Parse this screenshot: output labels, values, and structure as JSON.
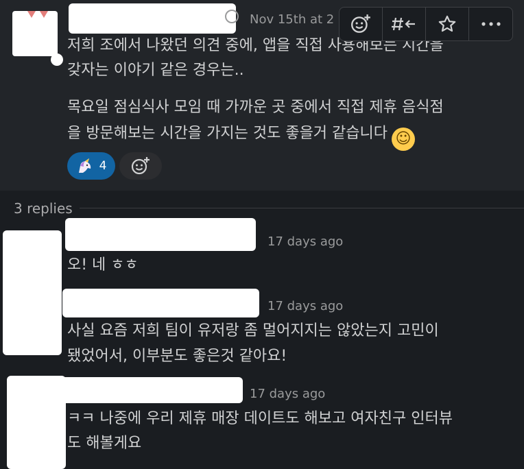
{
  "parent": {
    "timestamp": "Nov 15th at 2",
    "paragraph1_line1": "저희 조에서 나왔던 의견 중에, 앱을 직접 사용해보는 시간을",
    "paragraph1_line2": "갖자는 이야기 같은 경우는..",
    "paragraph2_line1": "목요일 점심식사 모임 때 가까운 곳 중에서 직접 제휴 음식점",
    "paragraph2_line2": "을 방문해보는 시간을 가지는 것도 좋을거 같습니다",
    "reactions": [
      {
        "emoji": "unicorn",
        "count": "4"
      }
    ]
  },
  "toolbar": {
    "icons": [
      "add-reaction-icon",
      "reply-in-channel-icon",
      "star-icon",
      "more-actions-icon"
    ]
  },
  "thread": {
    "replies_label": "3 replies",
    "replies": [
      {
        "timestamp": "17 days ago",
        "lines": [
          "오! 네 ㅎㅎ"
        ]
      },
      {
        "timestamp": "17 days ago",
        "lines": [
          "사실 요즘 저희 팀이 유저랑 좀 멀어지지는 않았는지 고민이",
          "됐었어서, 이부분도 좋은것 같아요!"
        ]
      },
      {
        "timestamp": "17 days ago",
        "lines": [
          "ㅋㅋ 나중에 우리 제휴 매장 데이트도 해보고 여자친구 인터뷰",
          "도 해볼게요"
        ]
      }
    ]
  },
  "colors": {
    "background": "#1a1d21",
    "hover_background": "#222529",
    "text": "#d1d2d3",
    "muted": "#9a9b9c",
    "reaction_active": "#1264a3"
  }
}
